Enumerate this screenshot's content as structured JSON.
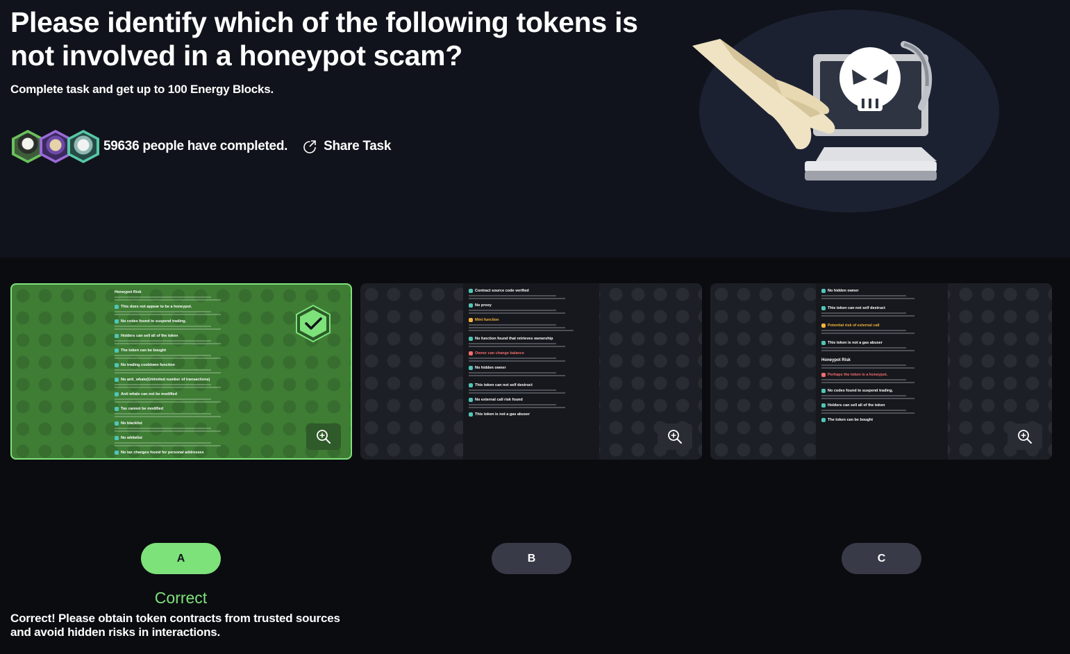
{
  "task": {
    "title": "Please identify which of the following tokens is not involved in a honeypot scam?",
    "subtitle": "Complete task and get up to 100 Energy Blocks.",
    "completed_text": "59636 people have completed.",
    "share_label": "Share Task"
  },
  "colors": {
    "accent_green": "#7de27a",
    "selected_card": "#3f7d35",
    "header_bg": "#10131b",
    "page_bg": "#0b0c10",
    "button_bg": "#383a48"
  },
  "options": [
    {
      "letter": "A",
      "selected": true,
      "doc_sections": [
        {
          "kind": "title",
          "text": "Honeypot Risk"
        },
        {
          "kind": "ok",
          "text": "This does not appear to be a honeypot."
        },
        {
          "kind": "ok",
          "text": "No codes found to suspend trading."
        },
        {
          "kind": "ok",
          "text": "Holders can sell all of the token"
        },
        {
          "kind": "ok",
          "text": "The token can be bought"
        },
        {
          "kind": "ok",
          "text": "No trading cooldown function"
        },
        {
          "kind": "ok",
          "text": "No anti_whale(Unlimited number of transactions)"
        },
        {
          "kind": "ok",
          "text": "Anti whale can not be modified"
        },
        {
          "kind": "ok",
          "text": "Tax cannot be modified"
        },
        {
          "kind": "ok",
          "text": "No blacklist"
        },
        {
          "kind": "ok",
          "text": "No whitelist"
        },
        {
          "kind": "ok",
          "text": "No tax changes found for personal addresses"
        }
      ]
    },
    {
      "letter": "B",
      "selected": false,
      "doc_sections": [
        {
          "kind": "ok",
          "text": "Contract source code verified"
        },
        {
          "kind": "ok",
          "text": "No proxy"
        },
        {
          "kind": "warn",
          "text": "Mint function"
        },
        {
          "kind": "ok",
          "text": "No function found that retrieves ownership"
        },
        {
          "kind": "danger",
          "text": "Owner can change balance"
        },
        {
          "kind": "ok",
          "text": "No hidden owner"
        },
        {
          "kind": "ok",
          "text": "This token can not self destruct"
        },
        {
          "kind": "ok",
          "text": "No external call risk found"
        },
        {
          "kind": "ok",
          "text": "This token is not a gas abuser"
        }
      ]
    },
    {
      "letter": "C",
      "selected": false,
      "doc_sections": [
        {
          "kind": "ok",
          "text": "No hidden owner"
        },
        {
          "kind": "ok",
          "text": "This token can not self destruct"
        },
        {
          "kind": "warn",
          "text": "Potential risk of external call"
        },
        {
          "kind": "ok",
          "text": "This token is not a gas abuser"
        },
        {
          "kind": "title",
          "text": "Honeypot Risk"
        },
        {
          "kind": "danger",
          "text": "Perhaps the token is a honeypot."
        },
        {
          "kind": "ok",
          "text": "No codes found to suspend trading."
        },
        {
          "kind": "ok",
          "text": "Holders can sell all of the token"
        },
        {
          "kind": "ok",
          "text": "The token can be bought"
        }
      ]
    }
  ],
  "result": {
    "title": "Correct",
    "message": "Correct! Please obtain token contracts from trusted sources and avoid hidden risks in interactions."
  },
  "icons": {
    "share": "share-icon",
    "zoom": "zoom-in-icon",
    "check": "checkmark-hexagon-icon",
    "hero": "hacker-skull-laptop-illustration"
  }
}
